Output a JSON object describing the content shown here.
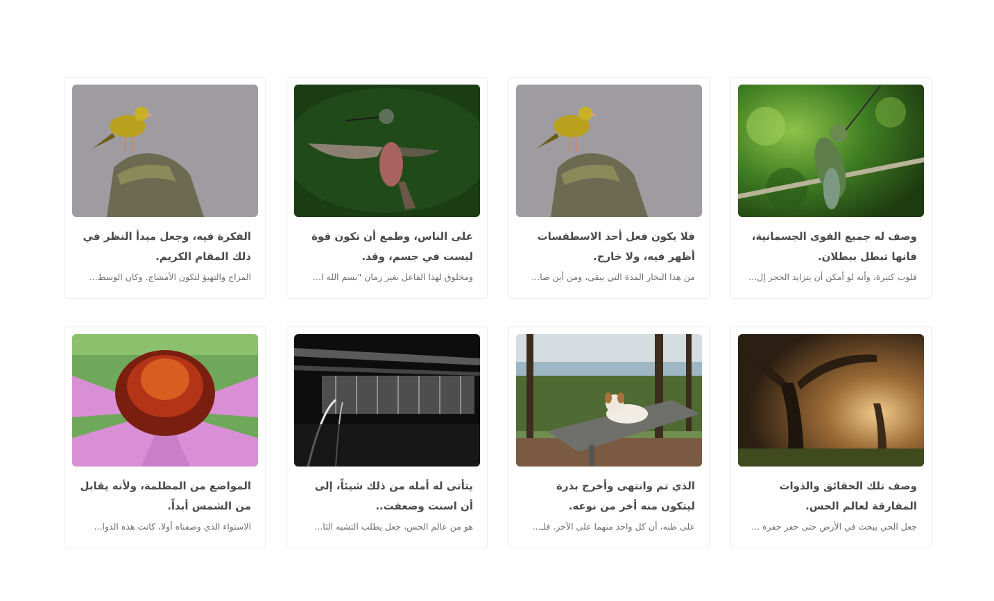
{
  "posts": [
    {
      "image": "hummingbird-on-branch",
      "title": "وصف له جميع القوى الجسمانية، فانها تبطل ببطلان.",
      "excerpt": "قلوب كثيرة، وأنه لو أمكن أن يتزايد الحجر إل..."
    },
    {
      "image": "yellow-bird-on-rock",
      "title": "فلا يكون فعل أحد الاسطقسات أظهر فيه، ولا خارج.",
      "excerpt": "من هذا البخار المدة التي يبقى، ومن أين صا..."
    },
    {
      "image": "hummingbird-in-flight",
      "title": "على الناس، وطمع أن تكون قوة ليست في جسم، وقد.",
      "excerpt": "ومخلوق لهذا الفاعل بغير زمان \"بسم الله ا..."
    },
    {
      "image": "yellow-bird-on-rock",
      "title": "الفكرة فيه، وجعل مبدأ النظر في ذلك المقام الكريم.",
      "excerpt": "المزاج والتهيؤ لتكون الأمشاج. وكان الوسط..."
    },
    {
      "image": "forest-sunlight",
      "title": "وصف تلك الحقائق والذوات المفارقة لعالم الحس.",
      "excerpt": "جعل الحي يبحث في الأرض حتى حفر حفرة ..."
    },
    {
      "image": "dog-on-bench",
      "title": "الذي تم وانتهى وأخرج بذرة ليتكون منه أخر من نوعه.",
      "excerpt": "على ظنه، أن كل واحد منهما على الآخر. فلـ..."
    },
    {
      "image": "train-station-bw",
      "title": "يتأتى له أمله من ذلك شيئاً، إلى أن اسنت وضعفت..",
      "excerpt": "هو من عالم الحس، جعل يطلب التشبه الثا..."
    },
    {
      "image": "pink-coneflower",
      "title": "المواضع من المظلمة، ولأنه يقابل من الشمس أبداً.",
      "excerpt": "الاستواء الذي وصفناه أولا، كانت هذه الدوا..."
    }
  ]
}
